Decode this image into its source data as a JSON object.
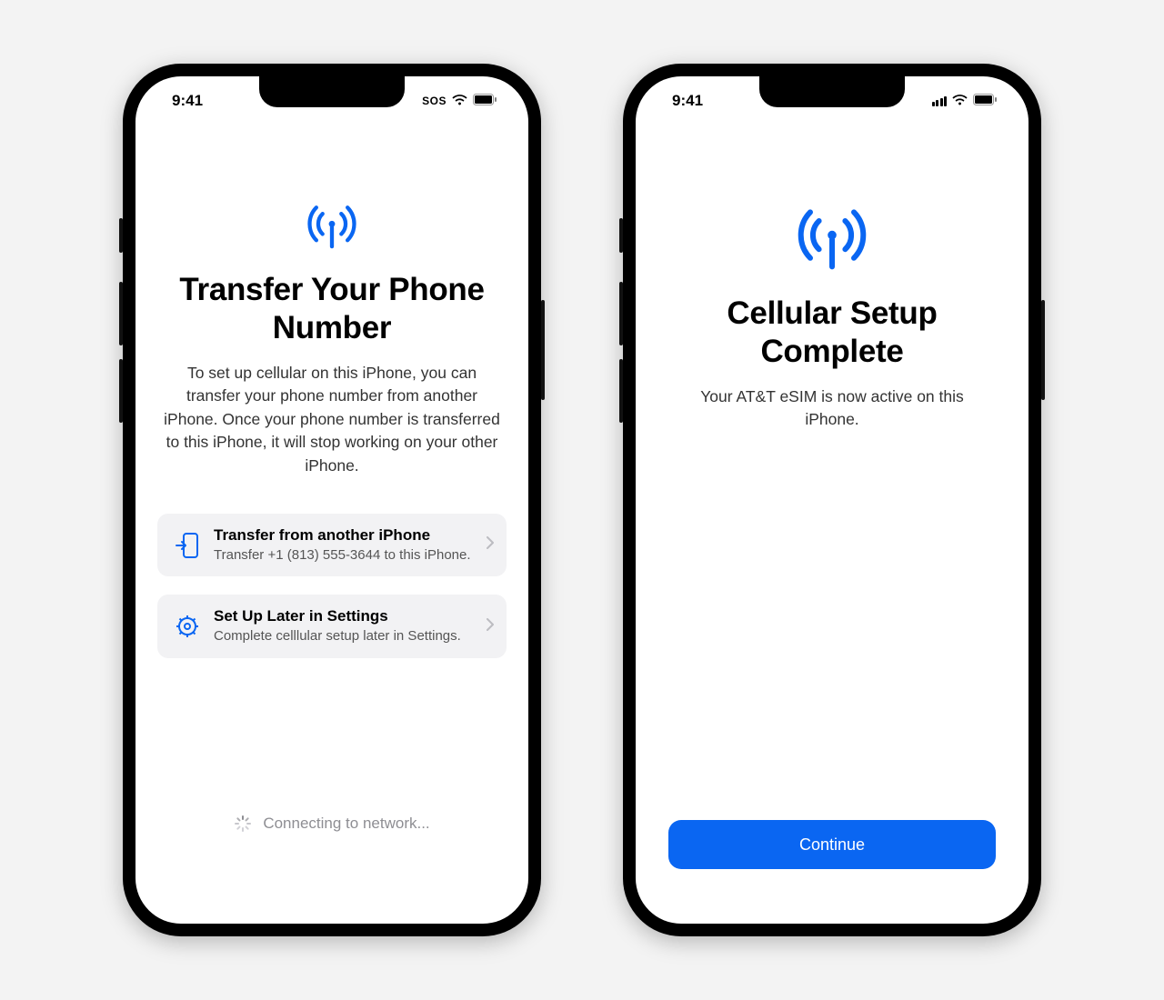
{
  "status": {
    "time": "9:41",
    "sos_label": "SOS"
  },
  "left_screen": {
    "title": "Transfer Your Phone Number",
    "description": "To set up cellular on this iPhone, you can transfer your phone number from another iPhone. Once your phone number is transferred to this iPhone, it will stop working on your other iPhone.",
    "option_transfer": {
      "title": "Transfer from another iPhone",
      "subtitle": "Transfer +1 (813) 555-3644 to this iPhone."
    },
    "option_later": {
      "title": "Set Up Later in Settings",
      "subtitle": "Complete celllular setup later in Settings."
    },
    "connecting_label": "Connecting to network..."
  },
  "right_screen": {
    "title": "Cellular Setup Complete",
    "description": "Your AT&T eSIM is now active on this iPhone.",
    "continue_label": "Continue"
  },
  "colors": {
    "accent": "#0a66f2"
  }
}
